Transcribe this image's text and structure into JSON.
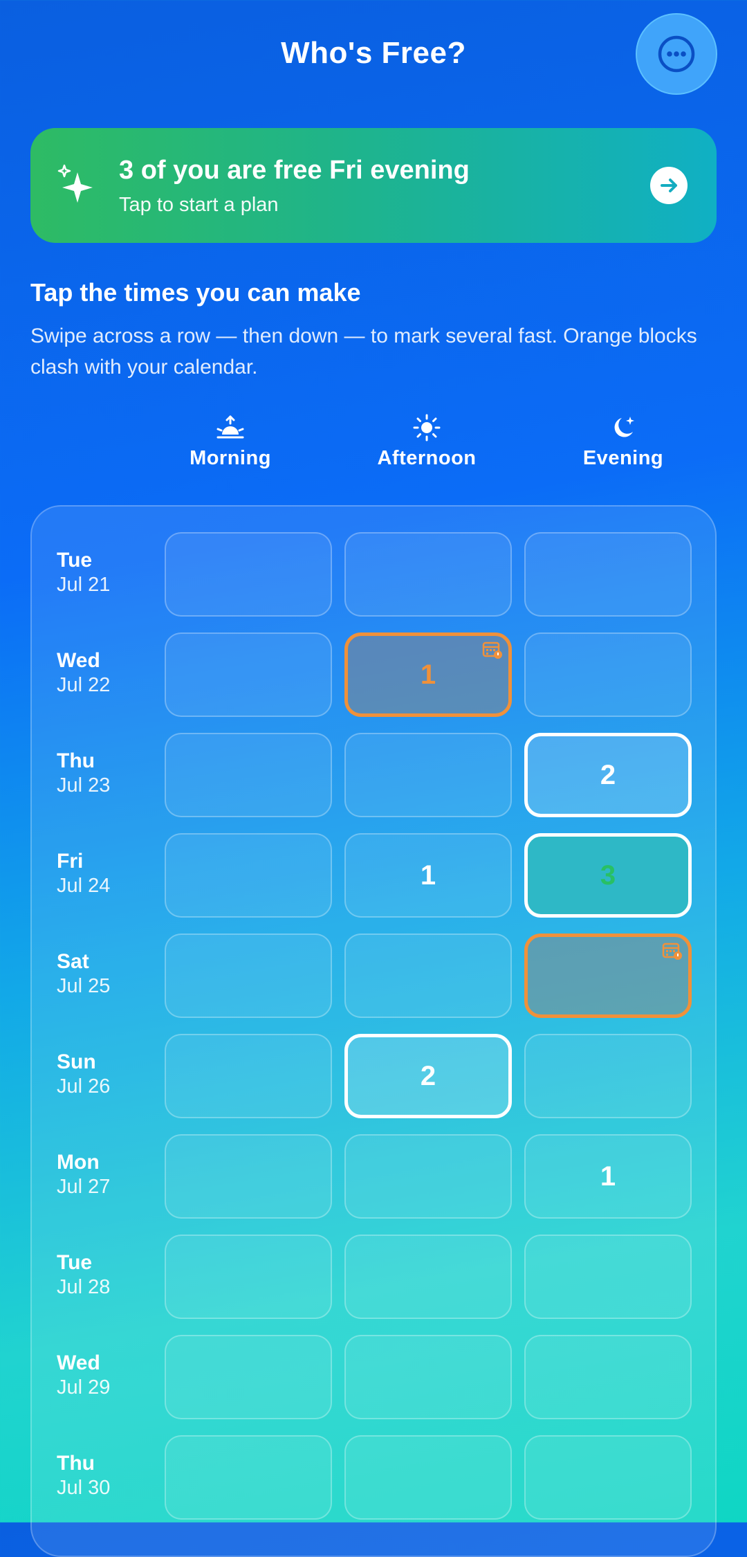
{
  "header": {
    "title": "Who's Free?",
    "more_icon": "ellipsis-icon"
  },
  "banner": {
    "title": "3 of you are free Fri evening",
    "subtitle": "Tap to start a plan",
    "icon": "sparkles-icon",
    "action_icon": "arrow-right-icon"
  },
  "instructions": {
    "title": "Tap the times you can make",
    "description": "Swipe across a row — then down — to mark several fast. Orange blocks clash with your calendar."
  },
  "columns": [
    {
      "label": "Morning",
      "icon": "sunrise-icon"
    },
    {
      "label": "Afternoon",
      "icon": "sun-icon"
    },
    {
      "label": "Evening",
      "icon": "moon-stars-icon"
    }
  ],
  "colors": {
    "clash": "#f0913a",
    "best": "#28c064",
    "best_fill": "#2eb8c6"
  },
  "rows": [
    {
      "day": "Tue",
      "date": "Jul 21",
      "cells": [
        {
          "count": "",
          "state": "empty"
        },
        {
          "count": "",
          "state": "empty"
        },
        {
          "count": "",
          "state": "empty"
        }
      ]
    },
    {
      "day": "Wed",
      "date": "Jul 22",
      "cells": [
        {
          "count": "",
          "state": "empty"
        },
        {
          "count": "1",
          "state": "clash"
        },
        {
          "count": "",
          "state": "empty"
        }
      ]
    },
    {
      "day": "Thu",
      "date": "Jul 23",
      "cells": [
        {
          "count": "",
          "state": "empty"
        },
        {
          "count": "",
          "state": "empty"
        },
        {
          "count": "2",
          "state": "selected"
        }
      ]
    },
    {
      "day": "Fri",
      "date": "Jul 24",
      "cells": [
        {
          "count": "",
          "state": "empty"
        },
        {
          "count": "1",
          "state": "empty"
        },
        {
          "count": "3",
          "state": "best"
        }
      ]
    },
    {
      "day": "Sat",
      "date": "Jul 25",
      "cells": [
        {
          "count": "",
          "state": "empty"
        },
        {
          "count": "",
          "state": "empty"
        },
        {
          "count": "",
          "state": "clash"
        }
      ]
    },
    {
      "day": "Sun",
      "date": "Jul 26",
      "cells": [
        {
          "count": "",
          "state": "empty"
        },
        {
          "count": "2",
          "state": "selected"
        },
        {
          "count": "",
          "state": "empty"
        }
      ]
    },
    {
      "day": "Mon",
      "date": "Jul 27",
      "cells": [
        {
          "count": "",
          "state": "empty"
        },
        {
          "count": "",
          "state": "empty"
        },
        {
          "count": "1",
          "state": "empty"
        }
      ]
    },
    {
      "day": "Tue",
      "date": "Jul 28",
      "cells": [
        {
          "count": "",
          "state": "empty"
        },
        {
          "count": "",
          "state": "empty"
        },
        {
          "count": "",
          "state": "empty"
        }
      ]
    },
    {
      "day": "Wed",
      "date": "Jul 29",
      "cells": [
        {
          "count": "",
          "state": "empty"
        },
        {
          "count": "",
          "state": "empty"
        },
        {
          "count": "",
          "state": "empty"
        }
      ]
    },
    {
      "day": "Thu",
      "date": "Jul 30",
      "cells": [
        {
          "count": "",
          "state": "empty"
        },
        {
          "count": "",
          "state": "empty"
        },
        {
          "count": "",
          "state": "empty"
        }
      ]
    }
  ]
}
